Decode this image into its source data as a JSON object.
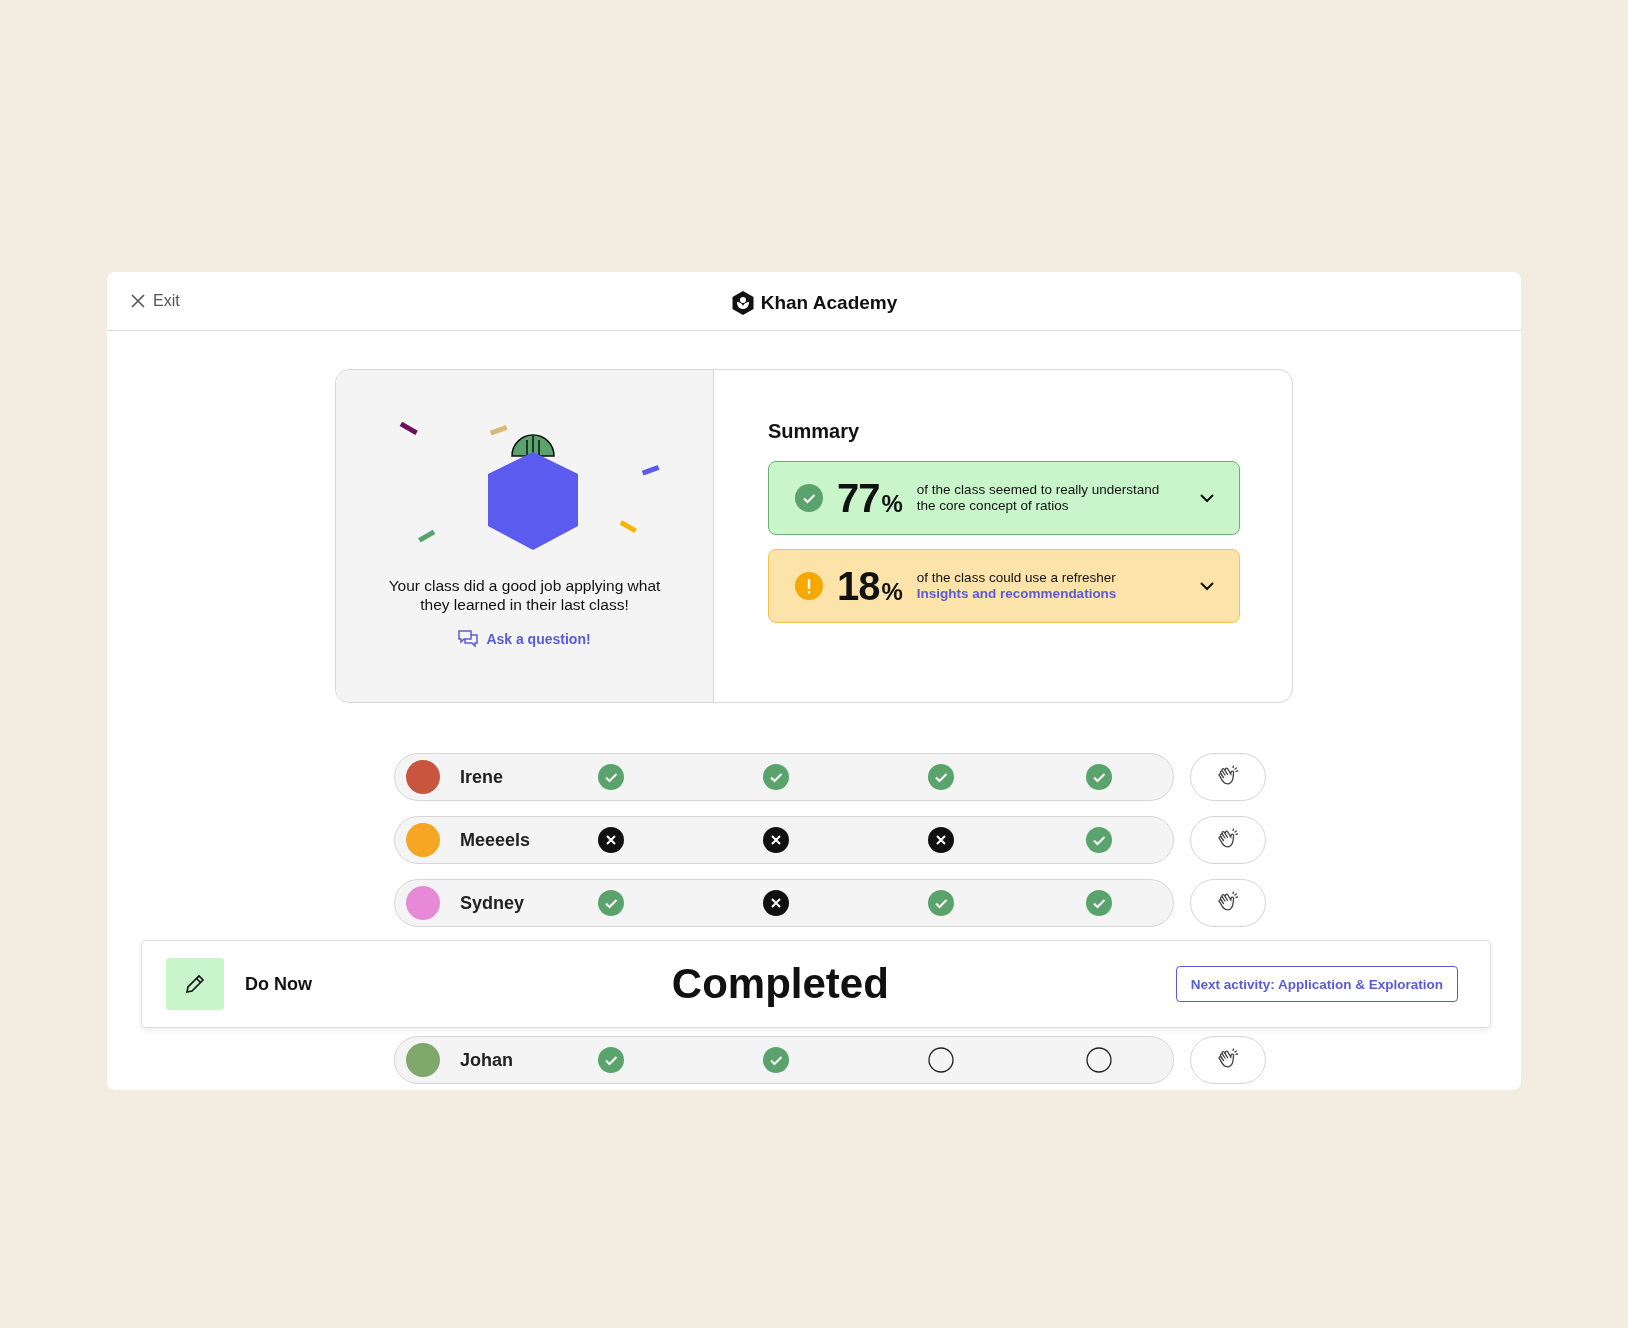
{
  "header": {
    "exit": "Exit",
    "logo": "Khan Academy"
  },
  "celebration": {
    "message": "Your class did a good job applying what they learned in their last class!",
    "link": "Ask a question!"
  },
  "summary": {
    "title": "Summary",
    "items": [
      {
        "kind": "success",
        "percent": "77",
        "unit": "%",
        "text": "of the class seemed to really understand the core concept of ratios",
        "expanded": false
      },
      {
        "kind": "warning",
        "percent": "18",
        "unit": "%",
        "text": "of the class could use a refresher",
        "link": "Insights and recommendations",
        "expanded": false
      }
    ]
  },
  "students": [
    {
      "name": "Irene",
      "color": "#c8553d",
      "results": [
        {
          "kind": "correct"
        },
        {
          "kind": "correct"
        },
        {
          "kind": "correct"
        },
        {
          "kind": "correct"
        }
      ]
    },
    {
      "name": "Meeeels",
      "color": "#f5a623",
      "results": [
        {
          "kind": "incorrect"
        },
        {
          "kind": "incorrect"
        },
        {
          "kind": "incorrect"
        },
        {
          "kind": "correct"
        }
      ]
    },
    {
      "name": "Sydney",
      "color": "#e889d8",
      "results": [
        {
          "kind": "correct"
        },
        {
          "kind": "incorrect"
        },
        {
          "kind": "correct"
        },
        {
          "kind": "correct"
        }
      ]
    },
    {
      "name": "Johan",
      "color": "#7fa86a",
      "results": [
        {
          "kind": "correct"
        },
        {
          "kind": "correct"
        },
        {
          "kind": "pending"
        },
        {
          "kind": "pending"
        }
      ]
    }
  ],
  "activity_bar": {
    "activity": "Do Now",
    "status": "Completed",
    "next": "Next activity: Application & Exploration"
  }
}
